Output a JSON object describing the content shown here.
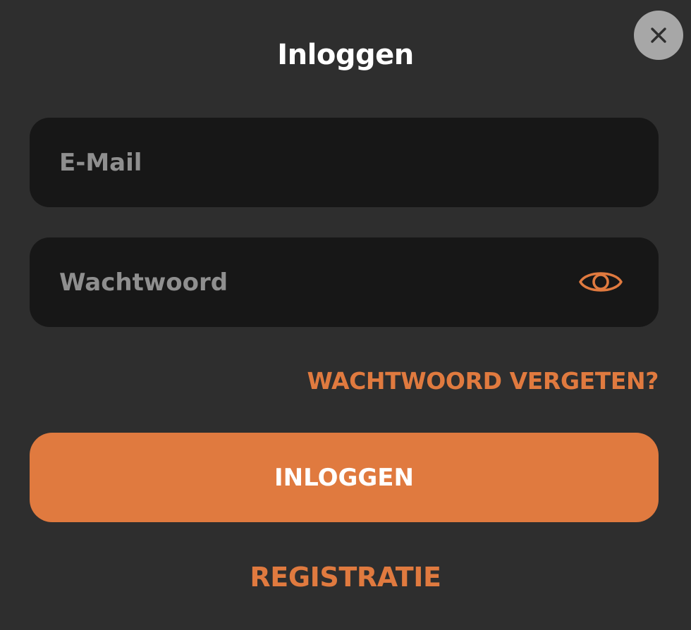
{
  "dialog": {
    "title": "Inloggen",
    "close_icon": "close-icon"
  },
  "form": {
    "email": {
      "placeholder": "E-Mail",
      "value": ""
    },
    "password": {
      "placeholder": "Wachtwoord",
      "value": "",
      "toggle_icon": "eye-icon"
    },
    "forgot_password_label": "WACHTWOORD VERGETEN?",
    "submit_label": "INLOGGEN",
    "register_label": "REGISTRATIE"
  },
  "colors": {
    "background": "#2e2e2e",
    "field_background": "#171717",
    "accent": "#e07a3f",
    "close_button": "#a7a7a7",
    "placeholder": "#8f8f8f",
    "text": "#ffffff"
  }
}
